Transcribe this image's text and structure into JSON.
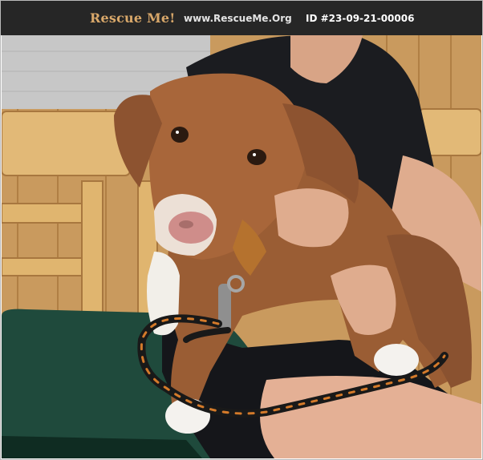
{
  "header": {
    "brand": "Rescue Me!",
    "site": "www.RescueMe.Org",
    "pet_id": "ID #23-09-21-00006"
  },
  "photo": {
    "subject": "brown and white puppy on a leash held by a person seated on a wooden chair"
  }
}
